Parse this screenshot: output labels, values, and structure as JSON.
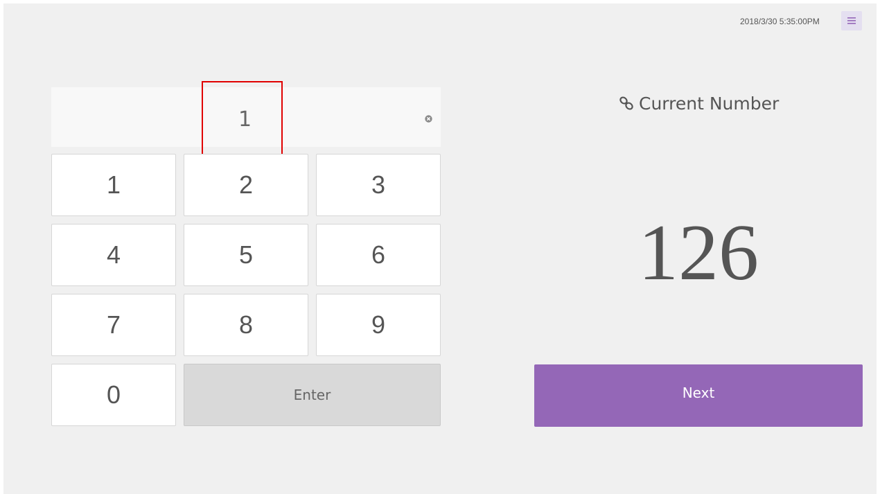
{
  "header": {
    "datetime": "2018/3/30 5:35:00PM",
    "menu_icon": "hamburger-menu-icon"
  },
  "input": {
    "value": "1",
    "clear_icon": "clear-circle-icon"
  },
  "keypad": {
    "keys": [
      "1",
      "2",
      "3",
      "4",
      "5",
      "6",
      "7",
      "8",
      "9",
      "0"
    ],
    "enter_label": "Enter"
  },
  "current": {
    "label": "Current Number",
    "label_icon": "link-icon",
    "number": "126"
  },
  "actions": {
    "next_label": "Next"
  },
  "colors": {
    "accent": "#9467b7",
    "background": "#f0f0f0",
    "highlight": "#e00000"
  }
}
